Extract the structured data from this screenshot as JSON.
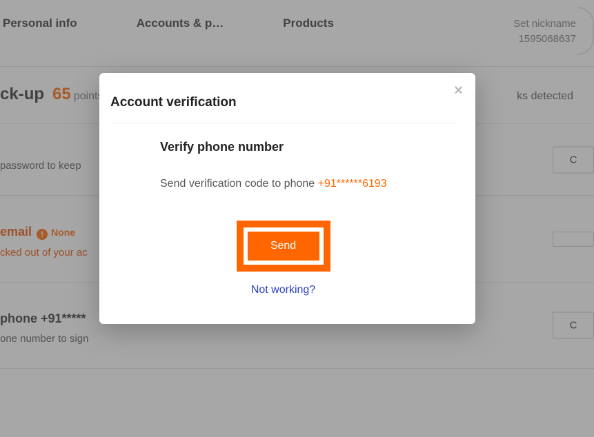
{
  "topnav": {
    "tab1": "Personal info",
    "tab2": "Accounts & p…",
    "tab3": "Products",
    "nick_label": "Set nickname",
    "nick_value": "1595068637"
  },
  "header": {
    "ckup": "ck-up",
    "score": "65",
    "points": "points",
    "risks": "ks detected"
  },
  "row_pw": {
    "desc": "password to keep",
    "btn": "C"
  },
  "row_email": {
    "title": "email",
    "none": "None",
    "desc": "cked out of your ac",
    "btn": " "
  },
  "row_phone": {
    "title": "phone +91*****",
    "desc": "one number to sign",
    "btn": "C"
  },
  "modal": {
    "title": "Account verification",
    "heading": "Verify phone number",
    "text_prefix": "Send verification code to phone ",
    "phone": "+91******6193",
    "send": "Send",
    "notworking": "Not working?"
  }
}
